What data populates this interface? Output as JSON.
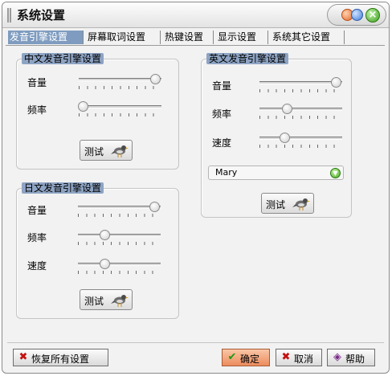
{
  "window": {
    "title": "系统设置"
  },
  "tabs": [
    {
      "label": "发音引擎设置",
      "active": true
    },
    {
      "label": "屏幕取词设置",
      "active": false
    },
    {
      "label": "热键设置",
      "active": false
    },
    {
      "label": "显示设置",
      "active": false
    },
    {
      "label": "系统其它设置",
      "active": false
    }
  ],
  "chinese_engine": {
    "legend": "中文发音引擎设置",
    "volume_label": "音量",
    "volume_value": 0.92,
    "rate_label": "频率",
    "rate_value": 0.05,
    "test_label": "测试"
  },
  "japanese_engine": {
    "legend": "日文发音引擎设置",
    "volume_label": "音量",
    "volume_value": 0.92,
    "rate_label": "频率",
    "rate_value": 0.32,
    "speed_label": "速度",
    "speed_value": 0.32,
    "test_label": "测试"
  },
  "english_engine": {
    "legend": "英文发音引擎设置",
    "volume_label": "音量",
    "volume_value": 0.92,
    "rate_label": "频率",
    "rate_value": 0.33,
    "speed_label": "速度",
    "speed_value": 0.3,
    "voice_value": "Mary",
    "test_label": "测试"
  },
  "footer": {
    "restore_label": "恢复所有设置",
    "ok_label": "确定",
    "cancel_label": "取消",
    "help_label": "帮助"
  },
  "colors": {
    "tab_active": "#7f9cc0",
    "legend_bg": "#8ea4c4",
    "ok_button": "#ec8c5e"
  }
}
